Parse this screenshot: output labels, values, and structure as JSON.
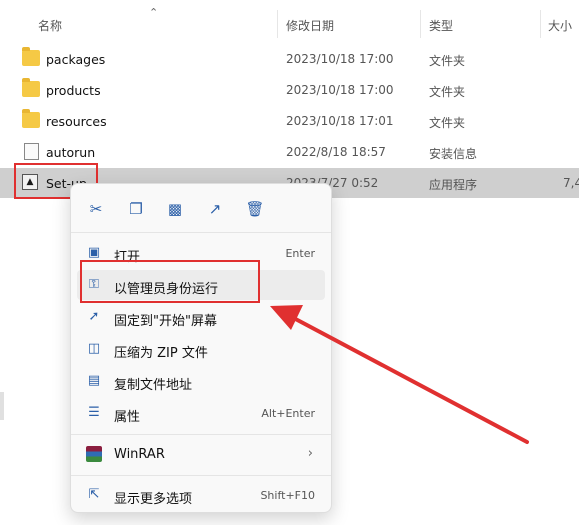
{
  "columns": {
    "name": "名称",
    "modified": "修改日期",
    "type": "类型",
    "size": "大小"
  },
  "files": [
    {
      "name": "packages",
      "date": "2023/10/18 17:00",
      "type": "文件夹",
      "size": "",
      "icon": "folder-icon"
    },
    {
      "name": "products",
      "date": "2023/10/18 17:00",
      "type": "文件夹",
      "size": "",
      "icon": "folder-icon"
    },
    {
      "name": "resources",
      "date": "2023/10/18 17:01",
      "type": "文件夹",
      "size": "",
      "icon": "folder-icon"
    },
    {
      "name": "autorun",
      "date": "2022/8/18 18:57",
      "type": "安装信息",
      "size": "",
      "icon": "settings-file-icon"
    },
    {
      "name": "Set-up",
      "date": "2023/7/27 0:52",
      "type": "应用程序",
      "size": "7,4",
      "icon": "app-icon"
    }
  ],
  "context_menu": {
    "quick_actions": [
      "cut-icon",
      "copy-icon",
      "rename-icon",
      "share-icon",
      "delete-icon"
    ],
    "items": [
      {
        "label": "打开",
        "shortcut": "Enter",
        "icon": "open-icon"
      },
      {
        "label": "以管理员身份运行",
        "shortcut": "",
        "icon": "shield-icon"
      },
      {
        "label": "固定到\"开始\"屏幕",
        "shortcut": "",
        "icon": "pin-icon"
      },
      {
        "label": "压缩为 ZIP 文件",
        "shortcut": "",
        "icon": "zip-icon"
      },
      {
        "label": "复制文件地址",
        "shortcut": "",
        "icon": "copy-path-icon"
      },
      {
        "label": "属性",
        "shortcut": "Alt+Enter",
        "icon": "properties-icon"
      },
      {
        "label": "WinRAR",
        "shortcut": "",
        "icon": "winrar-icon"
      },
      {
        "label": "显示更多选项",
        "shortcut": "Shift+F10",
        "icon": "more-options-icon"
      }
    ]
  },
  "colors": {
    "annotation_red": "#e03030",
    "selection": "#cfcfcf",
    "icon_blue": "#2b5fa8"
  }
}
